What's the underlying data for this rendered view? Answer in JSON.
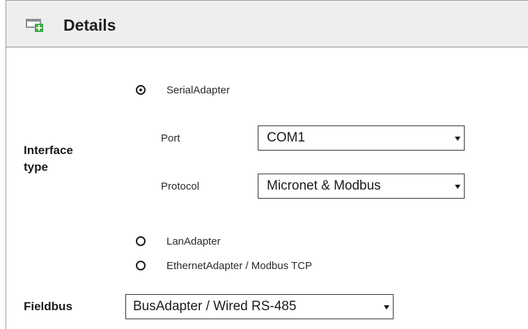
{
  "header": {
    "title": "Details",
    "icon": "add-window-icon"
  },
  "interface_type": {
    "label": "Interface type",
    "options": [
      {
        "label": "SerialAdapter",
        "selected": true
      },
      {
        "label": "LanAdapter",
        "selected": false
      },
      {
        "label": "EthernetAdapter / Modbus TCP",
        "selected": false
      }
    ],
    "port": {
      "label": "Port",
      "value": "COM1"
    },
    "protocol": {
      "label": "Protocol",
      "value": "Micronet & Modbus"
    }
  },
  "fieldbus": {
    "label": "Fieldbus",
    "value": "BusAdapter / Wired RS-485"
  },
  "colors": {
    "icon_green": "#3fae49",
    "icon_grey": "#8a8f96",
    "header_bg": "#eeeeee"
  }
}
